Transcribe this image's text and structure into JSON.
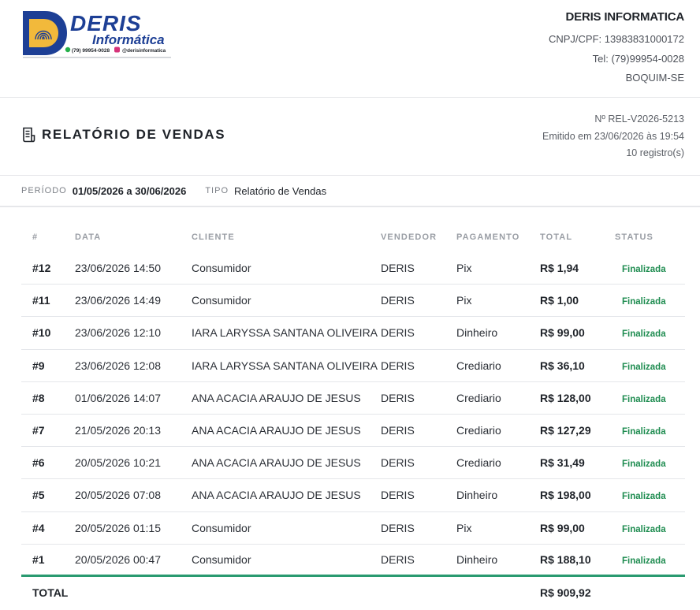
{
  "brand": {
    "logo_line1": "DERIS",
    "logo_line2": "Informática",
    "logo_phone": "(79) 99954-0028",
    "logo_instagram": "@derisinformatica",
    "primary_color": "#1d3f95",
    "accent_color": "#f2b93b"
  },
  "company": {
    "name": "DERIS INFORMATICA",
    "doc": "CNPJ/CPF: 13983831000172",
    "phone": "Tel: (79)99954-0028",
    "city": "BOQUIM-SE"
  },
  "report": {
    "title": "RELATÓRIO DE VENDAS",
    "icon": "receipt-icon",
    "number": "Nº REL-V2026-5213",
    "issued": "Emitido em 23/06/2026 às 19:54",
    "count": "10 registro(s)"
  },
  "filters": {
    "period_label": "PERÍODO",
    "period_value": "01/05/2026 a 30/06/2026",
    "type_label": "TIPO",
    "type_value": "Relatório de Vendas"
  },
  "table": {
    "headers": [
      "#",
      "DATA",
      "CLIENTE",
      "VENDEDOR",
      "PAGAMENTO",
      "TOTAL",
      "STATUS"
    ],
    "rows": [
      {
        "id": "#12",
        "date": "23/06/2026 14:50",
        "client": "Consumidor",
        "seller": "DERIS",
        "payment": "Pix",
        "total": "R$ 1,94",
        "status": "Finalizada"
      },
      {
        "id": "#11",
        "date": "23/06/2026 14:49",
        "client": "Consumidor",
        "seller": "DERIS",
        "payment": "Pix",
        "total": "R$ 1,00",
        "status": "Finalizada"
      },
      {
        "id": "#10",
        "date": "23/06/2026 12:10",
        "client": "IARA LARYSSA SANTANA OLIVEIRA",
        "seller": "DERIS",
        "payment": "Dinheiro",
        "total": "R$ 99,00",
        "status": "Finalizada"
      },
      {
        "id": "#9",
        "date": "23/06/2026 12:08",
        "client": "IARA LARYSSA SANTANA OLIVEIRA",
        "seller": "DERIS",
        "payment": "Crediario",
        "total": "R$ 36,10",
        "status": "Finalizada"
      },
      {
        "id": "#8",
        "date": "01/06/2026 14:07",
        "client": "ANA ACACIA ARAUJO DE JESUS",
        "seller": "DERIS",
        "payment": "Crediario",
        "total": "R$ 128,00",
        "status": "Finalizada"
      },
      {
        "id": "#7",
        "date": "21/05/2026 20:13",
        "client": "ANA ACACIA ARAUJO DE JESUS",
        "seller": "DERIS",
        "payment": "Crediario",
        "total": "R$ 127,29",
        "status": "Finalizada"
      },
      {
        "id": "#6",
        "date": "20/05/2026 10:21",
        "client": "ANA ACACIA ARAUJO DE JESUS",
        "seller": "DERIS",
        "payment": "Crediario",
        "total": "R$ 31,49",
        "status": "Finalizada"
      },
      {
        "id": "#5",
        "date": "20/05/2026 07:08",
        "client": "ANA ACACIA ARAUJO DE JESUS",
        "seller": "DERIS",
        "payment": "Dinheiro",
        "total": "R$ 198,00",
        "status": "Finalizada"
      },
      {
        "id": "#4",
        "date": "20/05/2026 01:15",
        "client": "Consumidor",
        "seller": "DERIS",
        "payment": "Pix",
        "total": "R$ 99,00",
        "status": "Finalizada"
      },
      {
        "id": "#1",
        "date": "20/05/2026 00:47",
        "client": "Consumidor",
        "seller": "DERIS",
        "payment": "Dinheiro",
        "total": "R$ 188,10",
        "status": "Finalizada"
      }
    ],
    "total_label": "TOTAL",
    "total_value": "R$ 909,92",
    "status_color": "#1e8c50",
    "total_rule_color": "#2a9a70"
  }
}
